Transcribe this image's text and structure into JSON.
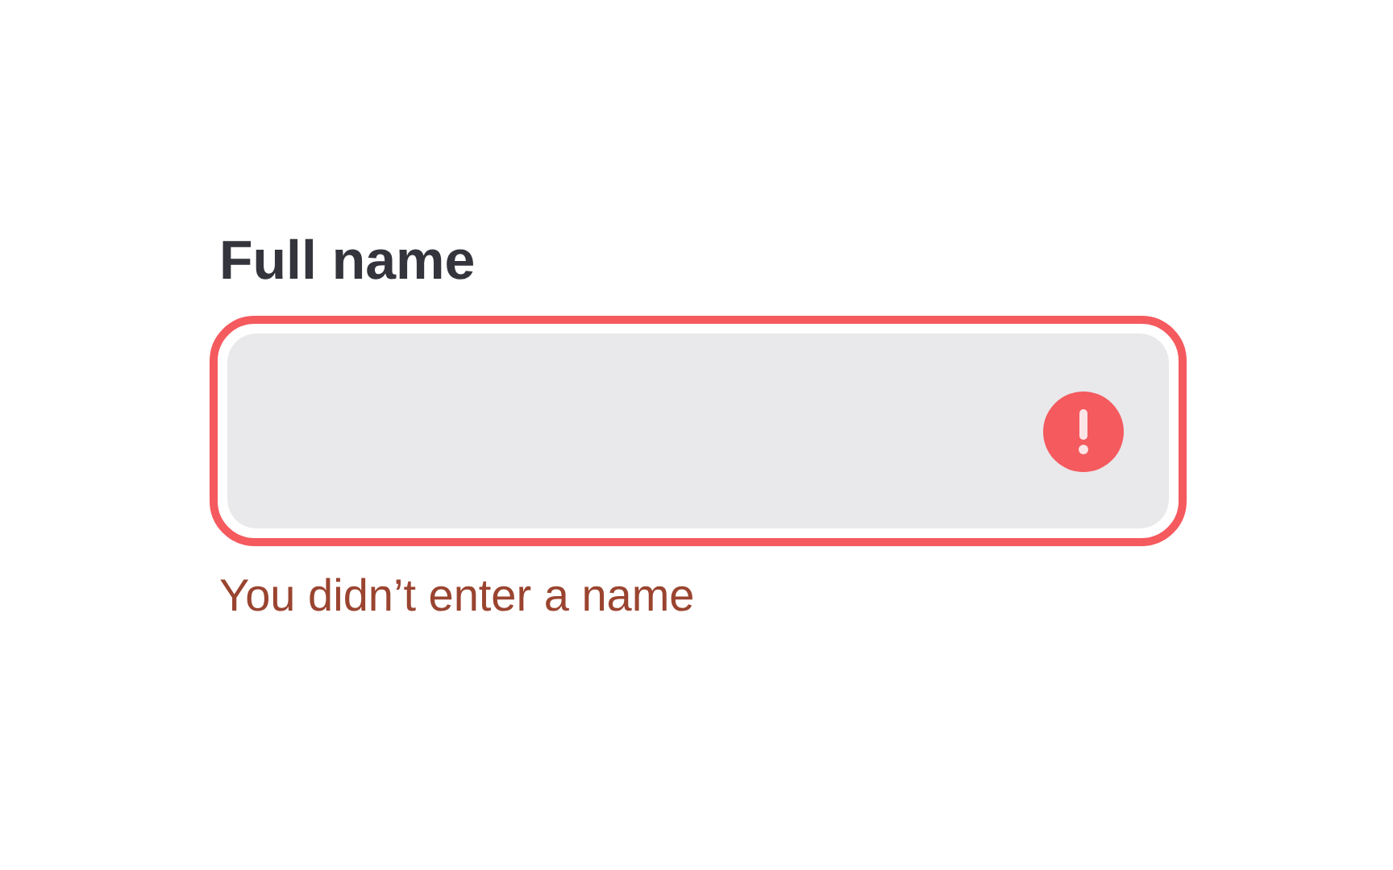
{
  "field": {
    "label": "Full name",
    "error": true,
    "error_message": "You didn’t enter a name"
  }
}
